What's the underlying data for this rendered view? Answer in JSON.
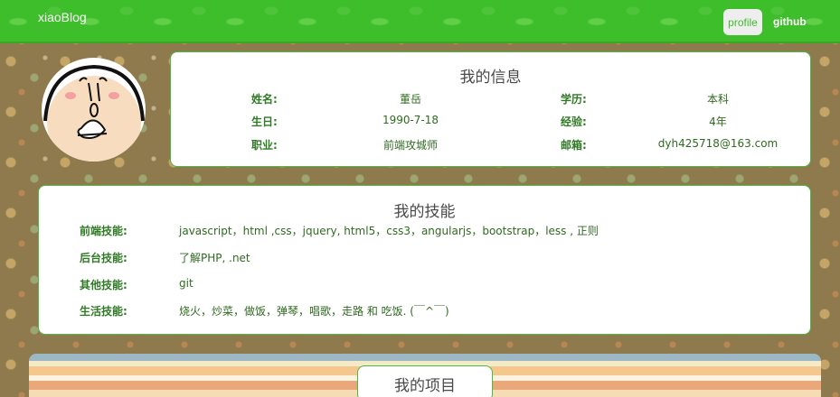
{
  "navbar": {
    "brand": "xiaoBlog",
    "profile_label": "profile",
    "github_label": "github"
  },
  "info": {
    "title": "我的信息",
    "rows": [
      {
        "label": "姓名:",
        "value": "董岳",
        "label2": "学历:",
        "value2": "本科"
      },
      {
        "label": "生日:",
        "value": "1990-7-18",
        "label2": "经验:",
        "value2": "4年"
      },
      {
        "label": "职业:",
        "value": "前端攻城师",
        "label2": "邮箱:",
        "value2": "dyh425718@163.com"
      }
    ]
  },
  "skills": {
    "title": "我的技能",
    "rows": [
      {
        "label": "前端技能:",
        "value": "javascript，html ,css，jquery, html5，css3，angularjs，bootstrap，less , 正则"
      },
      {
        "label": "后台技能:",
        "value": "了解PHP, .net"
      },
      {
        "label": "其他技能:",
        "value": "git"
      },
      {
        "label": "生活技能:",
        "value": "烧火，炒菜，做饭，弹琴，唱歌，走路 和 吃饭. (￣^￣)"
      }
    ]
  },
  "projects": {
    "title": "我的项目"
  }
}
